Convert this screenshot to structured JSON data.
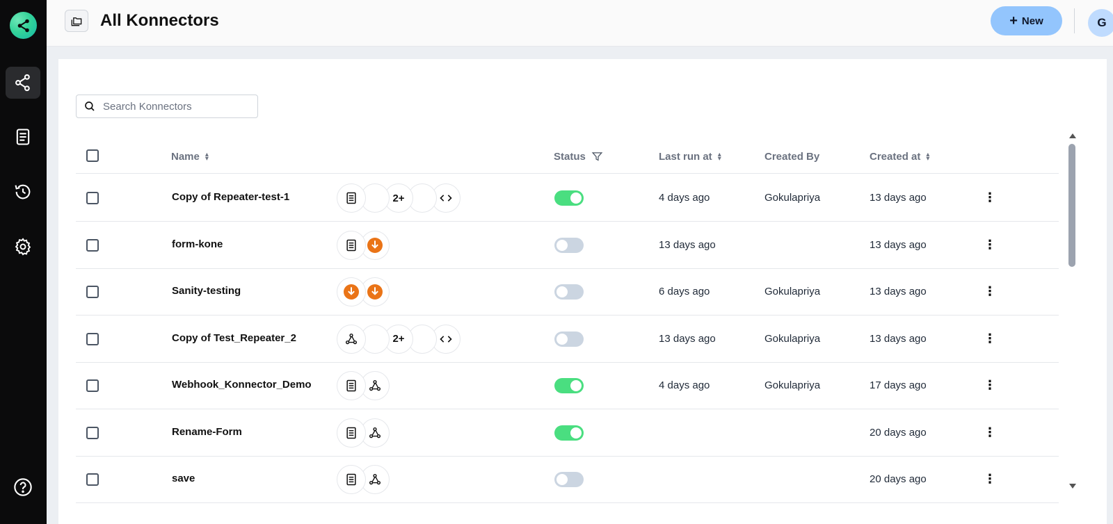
{
  "sidebar": {
    "items": [
      {
        "icon": "share-icon",
        "active": true
      },
      {
        "icon": "document-icon",
        "active": false
      },
      {
        "icon": "history-icon",
        "active": false
      },
      {
        "icon": "gear-icon",
        "active": false
      }
    ],
    "help_icon": "help-icon"
  },
  "header": {
    "title": "All Konnectors",
    "new_label": "New",
    "avatar_initial": "G"
  },
  "search": {
    "placeholder": "Search Konnectors"
  },
  "table": {
    "columns": {
      "name": "Name",
      "status": "Status",
      "last_run": "Last run at",
      "created_by": "Created By",
      "created_at": "Created at"
    },
    "rows": [
      {
        "name": "Copy of Repeater-test-1",
        "apps": [
          "document-icon",
          "blank",
          "2+",
          "blank",
          "code-icon"
        ],
        "enabled": true,
        "last_run": "4 days ago",
        "created_by": "Gokulapriya",
        "created_at": "13 days ago"
      },
      {
        "name": "form-kone",
        "apps": [
          "document-icon",
          "orange-app-icon"
        ],
        "enabled": false,
        "last_run": "13 days ago",
        "created_by": "",
        "created_at": "13 days ago"
      },
      {
        "name": "Sanity-testing",
        "apps": [
          "orange-app-icon",
          "orange-app-icon"
        ],
        "enabled": false,
        "last_run": "6 days ago",
        "created_by": "Gokulapriya",
        "created_at": "13 days ago"
      },
      {
        "name": "Copy of Test_Repeater_2",
        "apps": [
          "webhook-icon",
          "blank",
          "2+",
          "blank",
          "code-icon"
        ],
        "enabled": false,
        "last_run": "13 days ago",
        "created_by": "Gokulapriya",
        "created_at": "13 days ago"
      },
      {
        "name": "Webhook_Konnector_Demo",
        "apps": [
          "document-icon",
          "webhook-icon"
        ],
        "enabled": true,
        "last_run": "4 days ago",
        "created_by": "Gokulapriya",
        "created_at": "17 days ago"
      },
      {
        "name": "Rename-Form",
        "apps": [
          "document-icon",
          "webhook-icon"
        ],
        "enabled": true,
        "last_run": "",
        "created_by": "",
        "created_at": "20 days ago"
      },
      {
        "name": "save",
        "apps": [
          "document-icon",
          "webhook-icon"
        ],
        "enabled": false,
        "last_run": "",
        "created_by": "",
        "created_at": "20 days ago"
      }
    ]
  },
  "colors": {
    "sidebar_bg": "#0b0b0c",
    "accent_button": "#93c5fd",
    "toggle_on": "#4ade80",
    "toggle_off": "#cbd5e1",
    "orange_app": "#ea7417"
  }
}
